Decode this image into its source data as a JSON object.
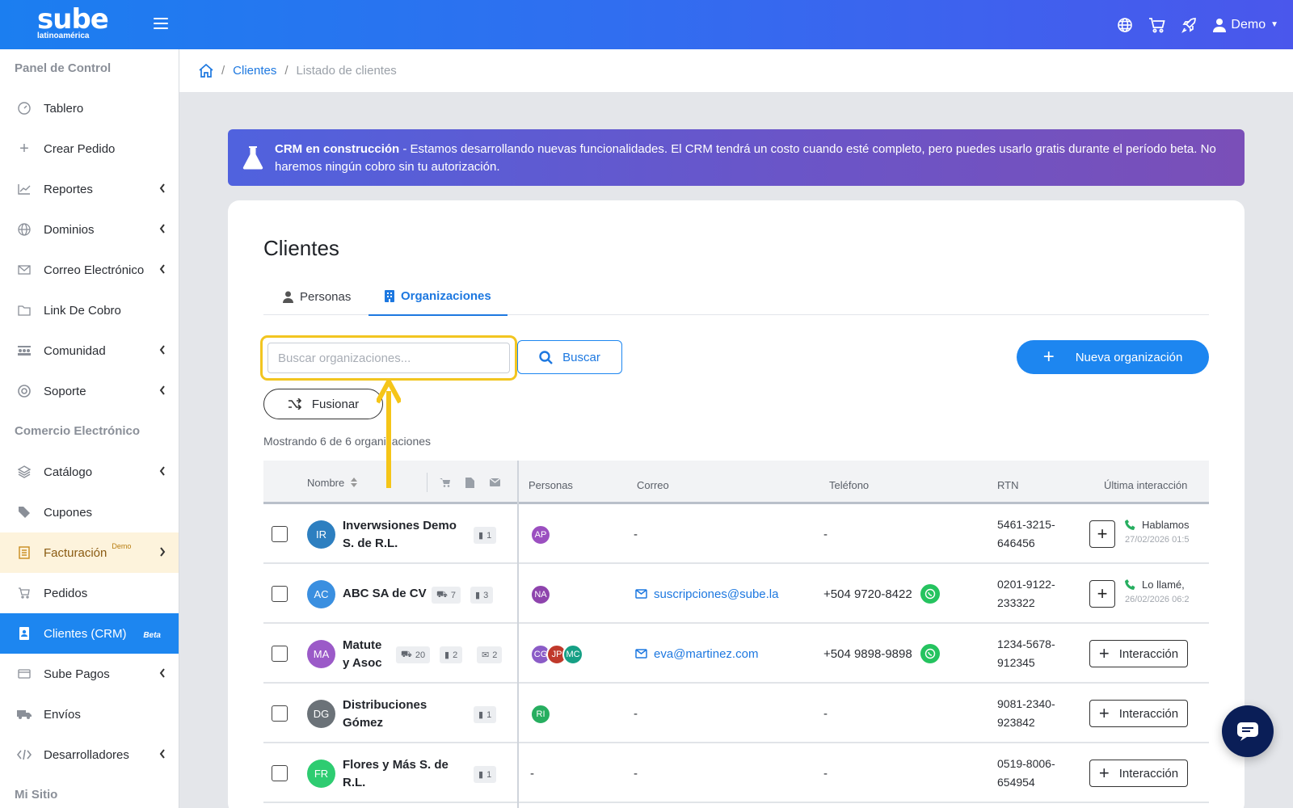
{
  "brand": {
    "name": "sube",
    "sub": "latinoamérica"
  },
  "topbar": {
    "user": "Demo"
  },
  "sidebar": {
    "sections": [
      "Panel de Control",
      "Comercio Electrónico",
      "Mi Sitio"
    ],
    "items": [
      {
        "label": "Tablero"
      },
      {
        "label": "Crear Pedido"
      },
      {
        "label": "Reportes"
      },
      {
        "label": "Dominios"
      },
      {
        "label": "Correo Electrónico"
      },
      {
        "label": "Link De Cobro"
      },
      {
        "label": "Comunidad"
      },
      {
        "label": "Soporte"
      },
      {
        "label": "Catálogo"
      },
      {
        "label": "Cupones"
      },
      {
        "label": "Facturación",
        "badge": "Demo"
      },
      {
        "label": "Pedidos"
      },
      {
        "label": "Clientes (CRM)",
        "badge": "Beta"
      },
      {
        "label": "Sube Pagos"
      },
      {
        "label": "Envíos"
      },
      {
        "label": "Desarrolladores"
      }
    ]
  },
  "breadcrumb": {
    "link": "Clientes",
    "current": "Listado de clientes"
  },
  "banner": {
    "title": "CRM en construcción",
    "text": " - Estamos desarrollando nuevas funcionalidades. El CRM tendrá un costo cuando esté completo, pero puedes usarlo gratis durante el período beta. No haremos ningún cobro sin tu autorización."
  },
  "page": {
    "title": "Clientes",
    "tabs": {
      "persons": "Personas",
      "orgs": "Organizaciones"
    },
    "search_placeholder": "Buscar organizaciones...",
    "search_button": "Buscar",
    "new_button": "Nueva organización",
    "merge_button": "Fusionar",
    "count_text": "Mostrando 6 de 6 organizaciones"
  },
  "table": {
    "headers": {
      "name": "Nombre",
      "persons": "Personas",
      "email": "Correo",
      "phone": "Teléfono",
      "rtn": "RTN",
      "last": "Última interacción"
    },
    "rows": [
      {
        "initials": "IR",
        "color": "#2d7fc0",
        "name": "Inverwsiones Demo S. de R.L.",
        "chips": [
          "1"
        ],
        "people": [
          {
            "i": "AP",
            "c": "#9b4fc0"
          }
        ],
        "email": "-",
        "phone": "-",
        "rtn1": "5461-3215-",
        "rtn2": "646456",
        "last": "Hablamos",
        "last_date": "27/02/2026 01:5"
      },
      {
        "initials": "AC",
        "color": "#3a8fe0",
        "name": "ABC SA de CV",
        "chips": [
          "7",
          "3"
        ],
        "people": [
          {
            "i": "NA",
            "c": "#8e44ad"
          }
        ],
        "email": "suscripciones@sube.la",
        "phone": "+504 9720-8422",
        "rtn1": "0201-9122-",
        "rtn2": "233322",
        "last": "Lo llamé,",
        "last_date": "26/02/2026 06:2"
      },
      {
        "initials": "MA",
        "color": "#9b5ac8",
        "name": "Matute y Asoc",
        "chips": [
          "20",
          "2",
          "2"
        ],
        "people": [
          {
            "i": "CG",
            "c": "#8b5cc7"
          },
          {
            "i": "JP",
            "c": "#c0392b"
          },
          {
            "i": "MC",
            "c": "#16a085"
          }
        ],
        "email": "eva@martinez.com",
        "phone": "+504 9898-9898",
        "rtn1": "1234-5678-",
        "rtn2": "912345",
        "action": "Interacción"
      },
      {
        "initials": "DG",
        "color": "#6b7278",
        "name": "Distribuciones Gómez",
        "chips": [
          "1"
        ],
        "people": [
          {
            "i": "RI",
            "c": "#27ae60"
          }
        ],
        "email": "-",
        "phone": "-",
        "rtn1": "9081-2340-",
        "rtn2": "923842",
        "action": "Interacción"
      },
      {
        "initials": "FR",
        "color": "#2ecc71",
        "name": "Flores y Más S. de R.L.",
        "chips": [
          "1"
        ],
        "people_text": "-",
        "email": "-",
        "phone": "-",
        "rtn1": "0519-8006-",
        "rtn2": "654954",
        "action": "Interacción"
      }
    ]
  }
}
